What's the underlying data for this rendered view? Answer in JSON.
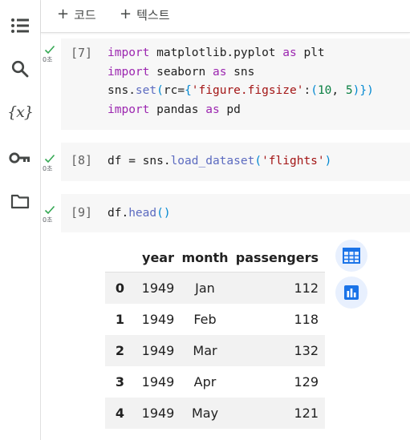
{
  "toolbar": {
    "add_code_label": "코드",
    "add_text_label": "텍스트",
    "plus_glyph": "+"
  },
  "sidebar": {
    "items": [
      {
        "name": "table-of-contents-icon"
      },
      {
        "name": "search-icon"
      },
      {
        "name": "variables-icon",
        "glyph": "{x}"
      },
      {
        "name": "secrets-key-icon"
      },
      {
        "name": "files-folder-icon"
      }
    ]
  },
  "cells": [
    {
      "exec_count": "[7]",
      "exec_time": "0초",
      "code_lines": [
        "import matplotlib.pyplot as plt",
        "import seaborn as sns",
        "sns.set(rc={'figure.figsize':(10, 5)})",
        "import pandas as pd"
      ]
    },
    {
      "exec_count": "[8]",
      "exec_time": "0초",
      "code_lines": [
        "df = sns.load_dataset('flights')"
      ]
    },
    {
      "exec_count": "[9]",
      "exec_time": "0초",
      "code_lines": [
        "df.head()"
      ]
    }
  ],
  "output_table": {
    "columns": [
      "year",
      "month",
      "passengers"
    ],
    "rows": [
      {
        "index": "0",
        "year": "1949",
        "month": "Jan",
        "passengers": "112"
      },
      {
        "index": "1",
        "year": "1949",
        "month": "Feb",
        "passengers": "118"
      },
      {
        "index": "2",
        "year": "1949",
        "month": "Mar",
        "passengers": "132"
      },
      {
        "index": "3",
        "year": "1949",
        "month": "Apr",
        "passengers": "129"
      },
      {
        "index": "4",
        "year": "1949",
        "month": "May",
        "passengers": "121"
      }
    ]
  },
  "colors": {
    "keyword": "#9c27b0",
    "string": "#a31515",
    "success_check": "#34a853",
    "accent": "#1a73e8",
    "cell_background": "#f7f7f7"
  }
}
